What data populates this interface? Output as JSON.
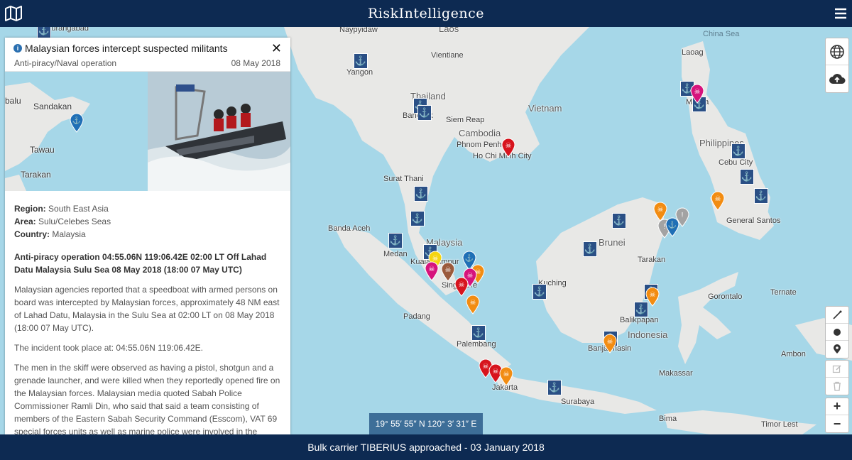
{
  "app": {
    "brand": "RiskIntelligence"
  },
  "panel": {
    "title": "Malaysian forces intercept suspected militants",
    "category": "Anti-piracy/Naval operation",
    "date": "08 May 2018",
    "mini_map_labels": [
      "balu",
      "Sandakan",
      "Tawau",
      "Tarakan"
    ],
    "region_label": "Region:",
    "region": "South East Asia",
    "area_label": "Area:",
    "area": "Sulu/Celebes Seas",
    "country_label": "Country:",
    "country": "Malaysia",
    "headline": "Anti-piracy operation 04:55.06N 119:06.42E 02:00 LT Off Lahad Datu Malaysia Sulu Sea 08 May 2018 (18:00 07 May UTC)",
    "p1": "Malaysian agencies reported that a speedboat with armed persons on board was intercepted by Malaysian forces, approximately 48 NM east of Lahad Datu, Malaysia in the Sulu Sea at 02:00 LT on 08 May 2018 (18:00 07 May UTC).",
    "p2": "The incident took place at: 04:55.06N 119:06.42E.",
    "p3": "The men in the skiff were observed as having a pistol, shotgun and a grenade launcher, and were killed when they reportedly opened fire on the Malaysian forces. Malaysian media quoted Sabah Police Commissioner Ramli Din, who said that said a team consisting of members of the Eastern Sabah Security Command (Esscom), VAT 69 special forces units as well as marine police were involved in the operation and intercepted the speedboat when it was seen moving"
  },
  "map": {
    "places": [
      {
        "name": "Aurangabad"
      },
      {
        "name": "Naypyidaw"
      },
      {
        "name": "Laos"
      },
      {
        "name": "China Sea"
      },
      {
        "name": "Vientiane"
      },
      {
        "name": "Yangon"
      },
      {
        "name": "Laoag"
      },
      {
        "name": "Thailand"
      },
      {
        "name": "Vietnam"
      },
      {
        "name": "Bangkok"
      },
      {
        "name": "Siem Reap"
      },
      {
        "name": "Manila"
      },
      {
        "name": "Cambodia"
      },
      {
        "name": "Phnom Penh"
      },
      {
        "name": "Ho Chi Minh City"
      },
      {
        "name": "Philippines"
      },
      {
        "name": "Surat Thani"
      },
      {
        "name": "Cebu City"
      },
      {
        "name": "General Santos"
      },
      {
        "name": "Banda Aceh"
      },
      {
        "name": "Malaysia"
      },
      {
        "name": "Brunei"
      },
      {
        "name": "Medan"
      },
      {
        "name": "Kuala Lumpur"
      },
      {
        "name": "Tarakan"
      },
      {
        "name": "Singapore"
      },
      {
        "name": "Kuching"
      },
      {
        "name": "Ternate"
      },
      {
        "name": "Gorontalo"
      },
      {
        "name": "Padang"
      },
      {
        "name": "Balikpapan"
      },
      {
        "name": "Indonesia"
      },
      {
        "name": "Palembang"
      },
      {
        "name": "Banjarmasin"
      },
      {
        "name": "Ambon"
      },
      {
        "name": "Makassar"
      },
      {
        "name": "Jakarta"
      },
      {
        "name": "Surabaya"
      },
      {
        "name": "Bima"
      },
      {
        "name": "Timor Lest"
      }
    ]
  },
  "icons": {
    "map": "map-icon",
    "menu": "hamburger-menu-icon",
    "close": "close-icon",
    "info": "info-icon",
    "globe": "globe-icon",
    "cloud": "cloud-upload-icon",
    "draw_line": "draw-line-icon",
    "draw_circle": "draw-circle-icon",
    "draw_marker": "marker-icon",
    "edit": "edit-icon",
    "delete": "trash-icon",
    "zoom_in": "zoom-in-icon",
    "zoom_out": "zoom-out-icon",
    "port": "anchor-icon",
    "incident": "skull-pin-icon"
  },
  "controls": {
    "zoom_in": "+",
    "zoom_out": "−"
  },
  "coordinates": "19° 55′ 55″ N 120° 3′ 31″ E",
  "footer": {
    "ticker": "Bulk carrier TIBERIUS approached - 03 January 2018"
  },
  "colors": {
    "navy": "#0d2a52",
    "sea": "#a6d7e8",
    "land": "#e8e8e6",
    "port": "#2a4f85",
    "pin_red": "#d7141d",
    "pin_orange": "#f28c12",
    "pin_magenta": "#d6137c",
    "pin_yellow": "#f4d511",
    "pin_brown": "#9b5a3c",
    "pin_grey": "#a3a3a3",
    "pin_blue": "#1f6fb6"
  }
}
